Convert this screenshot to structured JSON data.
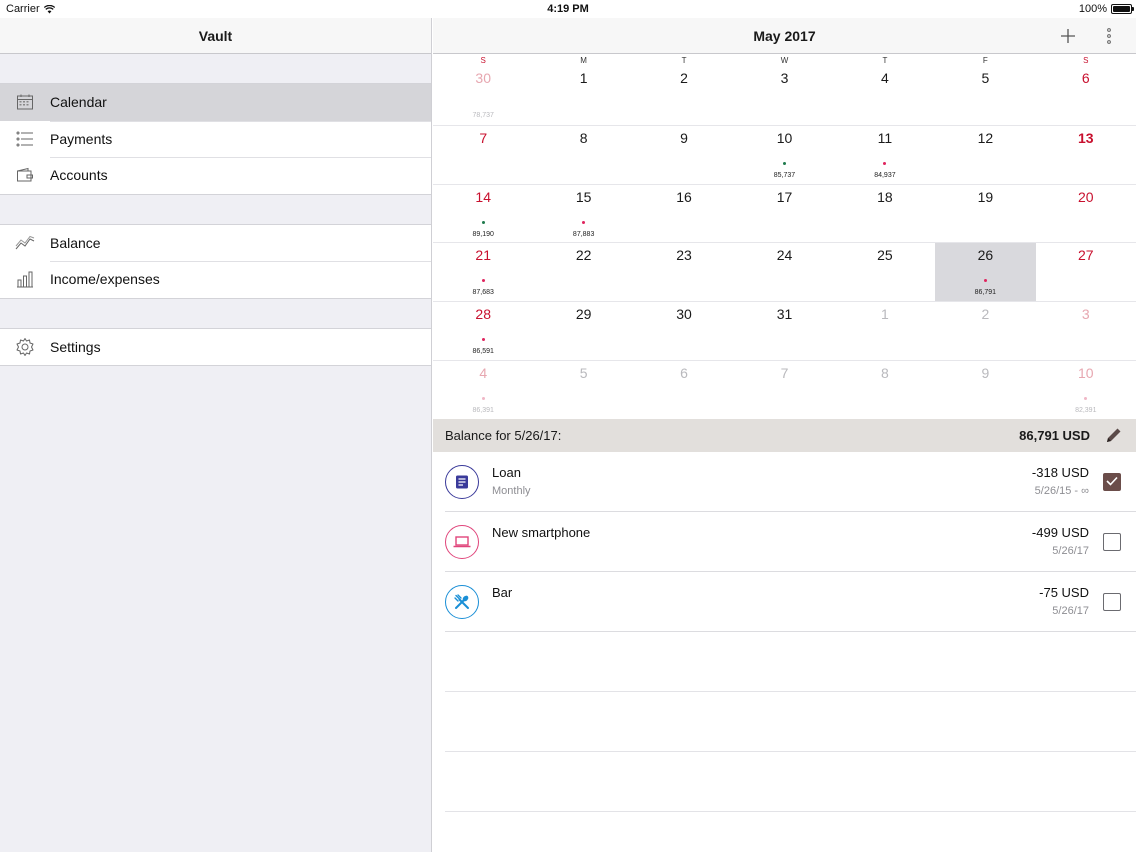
{
  "status_bar": {
    "carrier": "Carrier",
    "time": "4:19 PM",
    "battery": "100%"
  },
  "sidebar": {
    "title": "Vault",
    "groups": [
      {
        "items": [
          {
            "label": "Calendar",
            "icon": "calendar-icon",
            "active": true
          },
          {
            "label": "Payments",
            "icon": "list-icon",
            "active": false
          },
          {
            "label": "Accounts",
            "icon": "wallet-icon",
            "active": false
          }
        ]
      },
      {
        "items": [
          {
            "label": "Balance",
            "icon": "line-chart-icon",
            "active": false
          },
          {
            "label": "Income/expenses",
            "icon": "bar-chart-icon",
            "active": false
          }
        ]
      },
      {
        "items": [
          {
            "label": "Settings",
            "icon": "gear-icon",
            "active": false
          }
        ]
      }
    ]
  },
  "main": {
    "title": "May 2017",
    "weekdays": [
      "S",
      "M",
      "T",
      "W",
      "T",
      "F",
      "S"
    ],
    "calendar": [
      [
        {
          "d": "30",
          "o": true,
          "b": "78,737"
        },
        {
          "d": "1"
        },
        {
          "d": "2"
        },
        {
          "d": "3"
        },
        {
          "d": "4"
        },
        {
          "d": "5"
        },
        {
          "d": "6"
        }
      ],
      [
        {
          "d": "7"
        },
        {
          "d": "8"
        },
        {
          "d": "9"
        },
        {
          "d": "10",
          "dot": "green",
          "b": "85,737"
        },
        {
          "d": "11",
          "dot": "red",
          "b": "84,937"
        },
        {
          "d": "12"
        },
        {
          "d": "13",
          "bold": true
        }
      ],
      [
        {
          "d": "14",
          "dot": "green",
          "b": "89,190"
        },
        {
          "d": "15",
          "dot": "red",
          "b": "87,883"
        },
        {
          "d": "16"
        },
        {
          "d": "17"
        },
        {
          "d": "18"
        },
        {
          "d": "19"
        },
        {
          "d": "20"
        }
      ],
      [
        {
          "d": "21",
          "dot": "red",
          "b": "87,683"
        },
        {
          "d": "22"
        },
        {
          "d": "23"
        },
        {
          "d": "24"
        },
        {
          "d": "25"
        },
        {
          "d": "26",
          "dot": "red",
          "b": "86,791",
          "sel": true
        },
        {
          "d": "27"
        }
      ],
      [
        {
          "d": "28",
          "dot": "red",
          "b": "86,591"
        },
        {
          "d": "29"
        },
        {
          "d": "30"
        },
        {
          "d": "31"
        },
        {
          "d": "1",
          "o": true
        },
        {
          "d": "2",
          "o": true
        },
        {
          "d": "3",
          "o": true
        }
      ],
      [
        {
          "d": "4",
          "o": true,
          "dot": "red",
          "b": "86,391"
        },
        {
          "d": "5",
          "o": true
        },
        {
          "d": "6",
          "o": true
        },
        {
          "d": "7",
          "o": true
        },
        {
          "d": "8",
          "o": true
        },
        {
          "d": "9",
          "o": true
        },
        {
          "d": "10",
          "o": true,
          "dot": "red",
          "b": "82,391"
        }
      ]
    ],
    "balance": {
      "label": "Balance for 5/26/17:",
      "value": "86,791 USD"
    },
    "payments": [
      {
        "name": "Loan",
        "sub": "Monthly",
        "amount": "-318 USD",
        "date": "5/26/15 - ∞",
        "checked": true,
        "icon": "document-icon",
        "color": "#3a3a9a"
      },
      {
        "name": "New smartphone",
        "sub": "",
        "amount": "-499 USD",
        "date": "5/26/17",
        "checked": false,
        "icon": "laptop-icon",
        "color": "#e0457b"
      },
      {
        "name": "Bar",
        "sub": "",
        "amount": "-75 USD",
        "date": "5/26/17",
        "checked": false,
        "icon": "utensils-icon",
        "color": "#1a8fd6"
      }
    ]
  },
  "colors": {
    "weekend": "#c8102e",
    "dot_green": "#1f7a4d",
    "dot_red": "#e0245e",
    "checked": "#6b4d4a"
  }
}
